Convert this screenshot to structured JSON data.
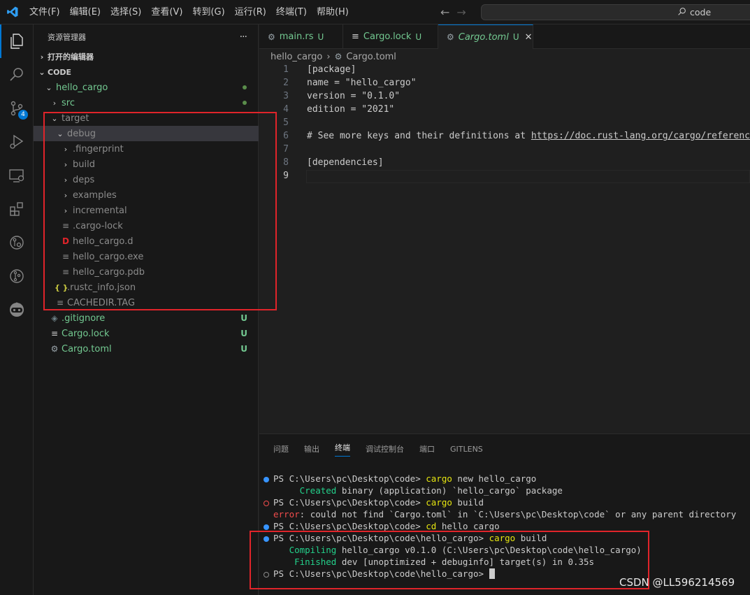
{
  "menu": [
    "文件(F)",
    "编辑(E)",
    "选择(S)",
    "查看(V)",
    "转到(G)",
    "运行(R)",
    "终端(T)",
    "帮助(H)"
  ],
  "search": {
    "text": "code"
  },
  "activity": {
    "scm_badge": "4"
  },
  "sidebar": {
    "title": "资源管理器",
    "more": "···",
    "open_editors": "打开的编辑器",
    "workspace": "CODE",
    "tree": {
      "hello_cargo": "hello_cargo",
      "src": "src",
      "target": "target",
      "debug": "debug",
      "fingerprint": ".fingerprint",
      "build": "build",
      "deps": "deps",
      "examples": "examples",
      "incremental": "incremental",
      "cargo_lock_file": ".cargo-lock",
      "hello_cargo_d": "hello_cargo.d",
      "hello_cargo_exe": "hello_cargo.exe",
      "hello_cargo_pdb": "hello_cargo.pdb",
      "rustc_info": ".rustc_info.json",
      "cachedir": "CACHEDIR.TAG",
      "gitignore": ".gitignore",
      "cargo_lock": "Cargo.lock",
      "cargo_toml": "Cargo.toml",
      "untracked": "U",
      "d_icon": "D",
      "json_icon": "{ }"
    }
  },
  "tabs": {
    "t1": "main.rs",
    "t2": "Cargo.lock",
    "t3": "Cargo.toml",
    "status": "U",
    "close": "✕"
  },
  "breadcrumb": {
    "folder": "hello_cargo",
    "file": "Cargo.toml"
  },
  "editor": {
    "line_numbers": [
      "1",
      "2",
      "3",
      "4",
      "5",
      "6",
      "7",
      "8",
      "9"
    ],
    "l1": "[package]",
    "l2": "name = \"hello_cargo\"",
    "l3": "version = \"0.1.0\"",
    "l4": "edition = \"2021\"",
    "l6a": "# See more keys and their definitions at ",
    "l6b": "https://doc.rust-lang.org/cargo/reference/",
    "l8": "[dependencies]"
  },
  "panel": {
    "tabs": [
      "问题",
      "输出",
      "终端",
      "调试控制台",
      "端口",
      "GITLENS"
    ],
    "active_tab": "终端"
  },
  "terminal": {
    "p1": "PS C:\\Users\\pc\\Desktop\\code> ",
    "c1a": "cargo",
    "c1b": " new hello_cargo",
    "o1a": "     Created",
    "o1b": " binary (application) `hello_cargo` package",
    "p2": "PS C:\\Users\\pc\\Desktop\\code> ",
    "c2a": "cargo",
    "c2b": " build",
    "o2a": "error",
    "o2b": ": could not find `Cargo.toml` in `C:\\Users\\pc\\Desktop\\code` or any parent directory",
    "p3": "PS C:\\Users\\pc\\Desktop\\code> ",
    "c3a": "cd",
    "c3b": " hello_cargo",
    "p4": "PS C:\\Users\\pc\\Desktop\\code\\hello_cargo> ",
    "c4a": "cargo",
    "c4b": " build",
    "o4a": "   Compiling",
    "o4b": " hello_cargo v0.1.0 (C:\\Users\\pc\\Desktop\\code\\hello_cargo)",
    "o5a": "    Finished",
    "o5b": " dev [unoptimized + debuginfo] target(s) in 0.35s",
    "p5": "PS C:\\Users\\pc\\Desktop\\code\\hello_cargo> "
  },
  "watermark": "CSDN @LL596214569",
  "colors": {
    "accent": "#0078d4",
    "annotation": "#e0242a",
    "untracked": "#73c991"
  }
}
